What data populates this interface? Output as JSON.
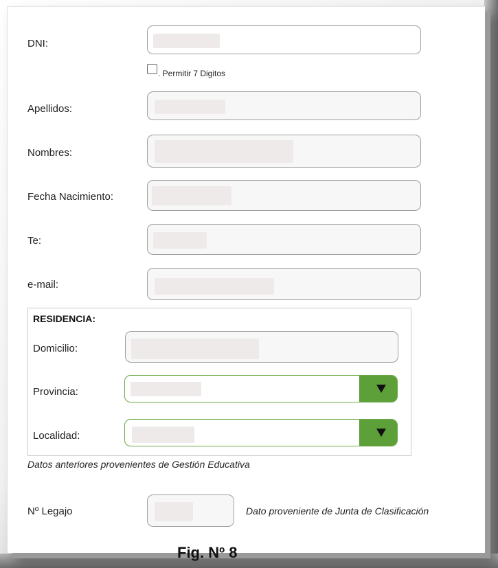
{
  "form": {
    "dni_label": "DNI:",
    "permit_checkbox_label": ". Permitir 7 Digitos",
    "permit_checked": false,
    "apellidos_label": "Apellidos:",
    "nombres_label": "Nombres:",
    "fecha_label": "Fecha Nacimiento:",
    "te_label": "Te:",
    "email_label": "e-mail:",
    "legajo_label": "Nº Legajo"
  },
  "residencia": {
    "title": "RESIDENCIA:",
    "domicilio_label": "Domicilio:",
    "provincia_label": "Provincia:",
    "localidad_label": "Localidad:"
  },
  "notes": {
    "gestion": "Datos anteriores provenientes de Gestión Educativa",
    "junta": "Dato proveniente de Junta de Clasificación"
  },
  "caption": "Fig. Nº 8",
  "colors": {
    "accent_green": "#5da03a",
    "field_border": "#9d9d9d",
    "redaction": "#eeeaea"
  },
  "icons": {
    "dropdown": "triangle-down"
  }
}
